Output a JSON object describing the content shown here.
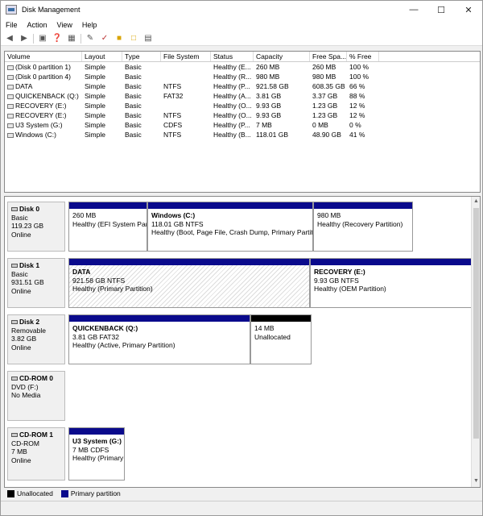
{
  "window": {
    "title": "Disk Management"
  },
  "menu": [
    "File",
    "Action",
    "View",
    "Help"
  ],
  "volumes": {
    "headers": [
      "Volume",
      "Layout",
      "Type",
      "File System",
      "Status",
      "Capacity",
      "Free Spa...",
      "% Free"
    ],
    "rows": [
      [
        "(Disk 0 partition 1)",
        "Simple",
        "Basic",
        "",
        "Healthy (E...",
        "260 MB",
        "260 MB",
        "100 %"
      ],
      [
        "(Disk 0 partition 4)",
        "Simple",
        "Basic",
        "",
        "Healthy (R...",
        "980 MB",
        "980 MB",
        "100 %"
      ],
      [
        "DATA",
        "Simple",
        "Basic",
        "NTFS",
        "Healthy (P...",
        "921.58 GB",
        "608.35 GB",
        "66 %"
      ],
      [
        "QUICKENBACK (Q:)",
        "Simple",
        "Basic",
        "FAT32",
        "Healthy (A...",
        "3.81 GB",
        "3.37 GB",
        "88 %"
      ],
      [
        "RECOVERY (E:)",
        "Simple",
        "Basic",
        "",
        "Healthy (O...",
        "9.93 GB",
        "1.23 GB",
        "12 %"
      ],
      [
        "RECOVERY (E:)",
        "Simple",
        "Basic",
        "NTFS",
        "Healthy (O...",
        "9.93 GB",
        "1.23 GB",
        "12 %"
      ],
      [
        "U3 System (G:)",
        "Simple",
        "Basic",
        "CDFS",
        "Healthy (P...",
        "7 MB",
        "0 MB",
        "0 %"
      ],
      [
        "Windows (C:)",
        "Simple",
        "Basic",
        "NTFS",
        "Healthy (B...",
        "118.01 GB",
        "48.90 GB",
        "41 %"
      ]
    ]
  },
  "disks": [
    {
      "name": "Disk 0",
      "l1": "Basic",
      "l2": "119.23 GB",
      "l3": "Online",
      "parts": [
        {
          "title": "",
          "size": "260 MB",
          "desc": "Healthy (EFI System Partition)"
        },
        {
          "title": "Windows (C:)",
          "size": "118.01 GB NTFS",
          "desc": "Healthy (Boot, Page File, Crash Dump, Primary Partition)"
        },
        {
          "title": "",
          "size": "980 MB",
          "desc": "Healthy (Recovery Partition)"
        }
      ]
    },
    {
      "name": "Disk 1",
      "l1": "Basic",
      "l2": "931.51 GB",
      "l3": "Online",
      "parts": [
        {
          "title": "DATA",
          "size": "921.58 GB NTFS",
          "desc": "Healthy (Primary Partition)"
        },
        {
          "title": "RECOVERY (E:)",
          "size": "9.93 GB NTFS",
          "desc": "Healthy (OEM Partition)"
        }
      ]
    },
    {
      "name": "Disk 2",
      "l1": "Removable",
      "l2": "3.82 GB",
      "l3": "Online",
      "parts": [
        {
          "title": "QUICKENBACK (Q:)",
          "size": "3.81 GB FAT32",
          "desc": "Healthy (Active, Primary Partition)"
        },
        {
          "title": "",
          "size": "14 MB",
          "desc": "Unallocated"
        }
      ]
    },
    {
      "name": "CD-ROM 0",
      "l1": "DVD (F:)",
      "l2": "",
      "l3": "No Media",
      "parts": []
    },
    {
      "name": "CD-ROM 1",
      "l1": "CD-ROM",
      "l2": "7 MB",
      "l3": "Online",
      "parts": [
        {
          "title": "U3 System (G:)",
          "size": "7 MB CDFS",
          "desc": "Healthy (Primary Partition)"
        }
      ]
    }
  ],
  "legend": {
    "unallocated": "Unallocated",
    "primary": "Primary partition"
  },
  "colors": {
    "primary": "#0a0a8c",
    "unallocated": "#000000"
  }
}
